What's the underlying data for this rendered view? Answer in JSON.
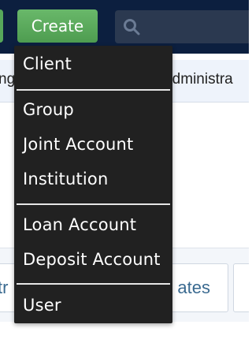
{
  "navbar": {
    "create_label": "Create"
  },
  "subnav": {
    "left_fragment": "ng",
    "right_fragment": "Administra"
  },
  "tabs": {
    "left_fragment": "tr",
    "mid_fragment": "ates"
  },
  "dropdown": {
    "items": [
      {
        "label": "Client"
      },
      {
        "label": "Group"
      },
      {
        "label": "Joint  Account"
      },
      {
        "label": "Institution"
      },
      {
        "label": "Loan  Account"
      },
      {
        "label": "Deposit  Account"
      },
      {
        "label": "User"
      }
    ]
  },
  "colors": {
    "navbar": "#0c1f3f",
    "create_button": "#57a85a",
    "dropdown": "#212121",
    "tab_text": "#3a6a90"
  }
}
